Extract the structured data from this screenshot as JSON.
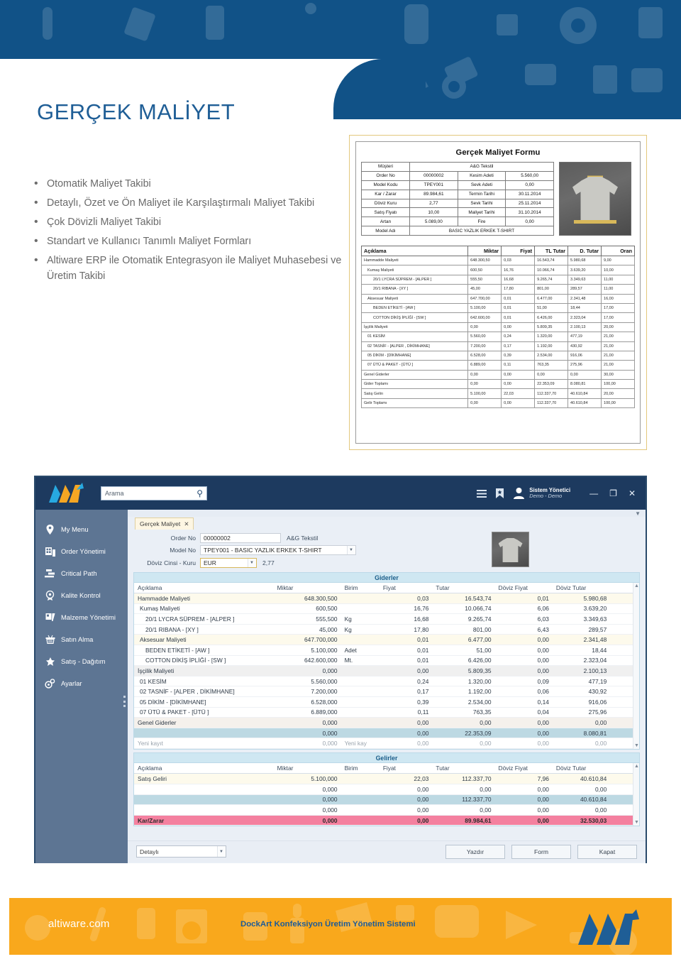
{
  "page": {
    "title": "GERÇEK MALİYET"
  },
  "bullets": [
    "Otomatik Maliyet Takibi",
    "Detaylı, Özet ve Ön Maliyet ile Karşılaştırmalı Maliyet Takibi",
    "Çok Dövizli Maliyet Takibi",
    "Standart ve Kullanıcı Tanımlı Maliyet Formları",
    "Altiware ERP ile Otomatik Entegrasyon ile Maliyet Muhasebesi ve Üretim Takibi"
  ],
  "report": {
    "title": "Gerçek Maliyet Formu",
    "header_rows": [
      {
        "label": "Müşteri",
        "value": "A&G Tekstil",
        "span": true
      },
      {
        "label": "Order No",
        "value": "00000002",
        "label2": "Kesim Adeti",
        "value2": "5.560,00"
      },
      {
        "label": "Model Kodu",
        "value": "TPEY001",
        "label2": "Sevk Adeti",
        "value2": "0,00"
      },
      {
        "label": "Kar / Zarar",
        "value": "89.984,61",
        "label2": "Termin Tarihi",
        "value2": "30.11.2014"
      },
      {
        "label": "Döviz Kuru",
        "value": "2,77",
        "label2": "Sevk Tarihi",
        "value2": "25.11.2014"
      },
      {
        "label": "Satış Fiyatı",
        "value": "10,00",
        "label2": "Maliyet Tarihi",
        "value2": "31.10.2014"
      },
      {
        "label": "Artan",
        "value": "5.089,00",
        "label2": "Fire",
        "value2": "0,00"
      },
      {
        "label": "Model Adı",
        "value": "BASIC YAZLIK ERKEK T-SHIRT",
        "span": true
      }
    ],
    "columns": [
      "Açıklama",
      "Miktar",
      "Fiyat",
      "TL Tutar",
      "D. Tutar",
      "Oran"
    ],
    "rows": [
      {
        "indent": 0,
        "thick": true,
        "cells": [
          "Hammadde Maliyeti",
          "648.300,50",
          "0,03",
          "16.543,74",
          "5.980,68",
          "9,00"
        ]
      },
      {
        "indent": 1,
        "thick": false,
        "cells": [
          "Kumaş Maliyeti",
          "600,50",
          "16,76",
          "10.066,74",
          "3.639,20",
          "10,00"
        ]
      },
      {
        "indent": 2,
        "thick": false,
        "cells": [
          "20/1 LYCRA SÜPREM - [ALPER ]",
          "555,50",
          "16,68",
          "9.265,74",
          "3.349,63",
          "11,00"
        ]
      },
      {
        "indent": 2,
        "thick": false,
        "cells": [
          "20/1 RIBANA - [XY ]",
          "45,00",
          "17,80",
          "801,00",
          "289,57",
          "11,00"
        ]
      },
      {
        "indent": 1,
        "thick": true,
        "cells": [
          "Aksesuar Maliyeti",
          "647.700,00",
          "0,01",
          "6.477,00",
          "2.341,48",
          "16,00"
        ]
      },
      {
        "indent": 2,
        "thick": false,
        "cells": [
          "BEDEN ETİKETİ - [AW ]",
          "5.100,00",
          "0,01",
          "51,00",
          "18,44",
          "17,00"
        ]
      },
      {
        "indent": 2,
        "thick": false,
        "cells": [
          "COTTON DİKİŞ İPLİĞİ - [SW ]",
          "642.600,00",
          "0,01",
          "6.426,00",
          "2.323,04",
          "17,00"
        ]
      },
      {
        "indent": 0,
        "thick": true,
        "cells": [
          "İşçilik Maliyeti",
          "0,00",
          "0,00",
          "5.809,35",
          "2.100,13",
          "20,00"
        ]
      },
      {
        "indent": 1,
        "thick": false,
        "cells": [
          "01  KESİM",
          "5.560,00",
          "0,24",
          "1.320,00",
          "477,19",
          "21,00"
        ]
      },
      {
        "indent": 1,
        "thick": false,
        "cells": [
          "02  TASNİF - [ALPER , DİKİMHANE]",
          "7.200,00",
          "0,17",
          "1.192,00",
          "430,92",
          "21,00"
        ]
      },
      {
        "indent": 1,
        "thick": false,
        "cells": [
          "05  DİKİM - [DİKİMHANE]",
          "6.528,00",
          "0,39",
          "2.534,00",
          "916,06",
          "21,00"
        ]
      },
      {
        "indent": 1,
        "thick": false,
        "cells": [
          "07  ÜTÜ & PAKET - [ÜTÜ ]",
          "6.889,00",
          "0,11",
          "763,35",
          "275,96",
          "21,00"
        ]
      },
      {
        "indent": 0,
        "thick": true,
        "cells": [
          "Genel Giderler",
          "0,00",
          "0,00",
          "0,00",
          "0,00",
          "30,00"
        ]
      },
      {
        "indent": 0,
        "thick": true,
        "cells": [
          "Gider Toplamı",
          "0,00",
          "0,00",
          "22.353,09",
          "8.080,81",
          "100,00"
        ]
      },
      {
        "indent": 0,
        "thick": true,
        "cells": [
          "Satış Gelirı",
          "5.100,00",
          "22,03",
          "112.337,70",
          "40.610,84",
          "20,00"
        ]
      },
      {
        "indent": 0,
        "thick": true,
        "cells": [
          "Gelir Toplamı",
          "0,00",
          "0,00",
          "112.337,70",
          "40.610,84",
          "100,00"
        ]
      }
    ]
  },
  "app": {
    "logo_alt": "AW",
    "search": {
      "placeholder": "Arama"
    },
    "user": {
      "name": "Sistem Yönetici",
      "sub": "Demo - Demo"
    },
    "window_buttons": {
      "minimize": "—",
      "maximize": "❐",
      "close": "✕"
    },
    "sidebar": [
      {
        "label": "My Menu",
        "icon": "pin-icon"
      },
      {
        "label": "Order Yönetimi",
        "icon": "documents-icon"
      },
      {
        "label": "Critical Path",
        "icon": "gantt-icon"
      },
      {
        "label": "Kalite Kontrol",
        "icon": "badge-icon"
      },
      {
        "label": "Malzeme Yönetimi",
        "icon": "cart-icon"
      },
      {
        "label": "Satın Alma",
        "icon": "basket-icon"
      },
      {
        "label": "Satış - Dağıtım",
        "icon": "share-icon"
      },
      {
        "label": "Ayarlar",
        "icon": "gear-icon"
      }
    ],
    "tab": {
      "label": "Gerçek Maliyet",
      "close": "✕"
    },
    "form": {
      "order_no_label": "Order No",
      "order_no_value": "00000002",
      "customer": "A&G Tekstil",
      "model_no_label": "Model No",
      "model_no_value": "TPEY001 - BASIC YAZLIK ERKEK T-SHIRT",
      "currency_label": "Döviz Cinsi - Kuru",
      "currency_value": "EUR",
      "rate_value": "2,77"
    },
    "expenses": {
      "section_title": "Giderler",
      "columns": [
        "Açıklama",
        "Miktar",
        "Birim",
        "Fiyat",
        "Tutar",
        "Döviz Fiyat",
        "Döviz Tutar",
        ""
      ],
      "rows": [
        {
          "style": "r-group",
          "cells": [
            "Hammadde Maliyeti",
            "648.300,500",
            "",
            "0,03",
            "16.543,74",
            "0,01",
            "5.980,68",
            ""
          ],
          "indent": 0
        },
        {
          "style": "",
          "cells": [
            "Kumaş Maliyeti",
            "600,500",
            "",
            "16,76",
            "10.066,74",
            "6,06",
            "3.639,20",
            ""
          ],
          "indent": 1
        },
        {
          "style": "",
          "cells": [
            "20/1 LYCRA SÜPREM - [ALPER ]",
            "555,500",
            "Kg",
            "16,68",
            "9.265,74",
            "6,03",
            "3.349,63",
            ""
          ],
          "indent": 2
        },
        {
          "style": "",
          "cells": [
            "20/1 RIBANA - [XY ]",
            "45,000",
            "Kg",
            "17,80",
            "801,00",
            "6,43",
            "289,57",
            ""
          ],
          "indent": 2
        },
        {
          "style": "r-group",
          "cells": [
            "Aksesuar Maliyeti",
            "647.700,000",
            "",
            "0,01",
            "6.477,00",
            "0,00",
            "2.341,48",
            ""
          ],
          "indent": 1
        },
        {
          "style": "",
          "cells": [
            "BEDEN ETİKETİ - [AW ]",
            "5.100,000",
            "Adet",
            "0,01",
            "51,00",
            "0,00",
            "18,44",
            ""
          ],
          "indent": 2
        },
        {
          "style": "",
          "cells": [
            "COTTON DİKİŞ İPLİĞİ - [SW ]",
            "642.600,000",
            "Mt.",
            "0,01",
            "6.426,00",
            "0,00",
            "2.323,04",
            ""
          ],
          "indent": 2
        },
        {
          "style": "r-alt",
          "cells": [
            "İşçilik Maliyeti",
            "0,000",
            "",
            "0,00",
            "5.809,35",
            "0,00",
            "2.100,13",
            ""
          ],
          "indent": 0
        },
        {
          "style": "",
          "cells": [
            "01  KESİM",
            "5.560,000",
            "",
            "0,24",
            "1.320,00",
            "0,09",
            "477,19",
            ""
          ],
          "indent": 1
        },
        {
          "style": "",
          "cells": [
            "02  TASNİF - [ALPER , DİKİMHANE]",
            "7.200,000",
            "",
            "0,17",
            "1.192,00",
            "0,06",
            "430,92",
            ""
          ],
          "indent": 1
        },
        {
          "style": "",
          "cells": [
            "05  DİKİM - [DİKİMHANE]",
            "6.528,000",
            "",
            "0,39",
            "2.534,00",
            "0,14",
            "916,06",
            ""
          ],
          "indent": 1
        },
        {
          "style": "",
          "cells": [
            "07  ÜTÜ & PAKET - [ÜTÜ ]",
            "6.889,000",
            "",
            "0,11",
            "763,35",
            "0,04",
            "275,96",
            ""
          ],
          "indent": 1
        },
        {
          "style": "r-group2",
          "cells": [
            "Genel Giderler",
            "0,000",
            "",
            "0,00",
            "0,00",
            "0,00",
            "0,00",
            ""
          ],
          "indent": 0
        },
        {
          "style": "r-sum",
          "cells": [
            "",
            "0,000",
            "",
            "0,00",
            "22.353,09",
            "0,00",
            "8.080,81",
            ""
          ],
          "indent": 0
        },
        {
          "style": "r-new",
          "cells": [
            "Yeni kayıt",
            "0,000",
            "Yeni kay",
            "0,00",
            "0,00",
            "0,00",
            "0,00",
            ""
          ],
          "indent": 0
        }
      ]
    },
    "income": {
      "section_title": "Gelirler",
      "columns": [
        "Açıklama",
        "Miktar",
        "Birim",
        "Fiyat",
        "Tutar",
        "Döviz Fiyat",
        "Döviz Tutar",
        ""
      ],
      "rows": [
        {
          "style": "r-inc1",
          "cells": [
            "Satış Geliri",
            "5.100,000",
            "",
            "22,03",
            "112.337,70",
            "7,96",
            "40.610,84",
            ""
          ],
          "indent": 0
        },
        {
          "style": "",
          "cells": [
            "",
            "0,000",
            "",
            "0,00",
            "0,00",
            "0,00",
            "0,00",
            ""
          ],
          "indent": 0
        },
        {
          "style": "r-inc3",
          "cells": [
            "",
            "0,000",
            "",
            "0,00",
            "112.337,70",
            "0,00",
            "40.610,84",
            ""
          ],
          "indent": 0
        },
        {
          "style": "",
          "cells": [
            "",
            "0,000",
            "",
            "0,00",
            "0,00",
            "0,00",
            "0,00",
            ""
          ],
          "indent": 0
        },
        {
          "style": "r-profit",
          "cells": [
            "Kar/Zarar",
            "0,000",
            "",
            "0,00",
            "89.984,61",
            "0,00",
            "32.530,03",
            ""
          ],
          "indent": 0
        }
      ]
    },
    "footer": {
      "mode_value": "Detaylı",
      "buttons": [
        "Yazdır",
        "Form",
        "Kapat"
      ]
    }
  },
  "footer": {
    "site": "altiware.com",
    "center": "DockArt Konfeksiyon Üretim Yönetim Sistemi"
  },
  "colors": {
    "banner_blue": "#115287",
    "title_blue": "#1f5e96",
    "sidebar": "#5d7593",
    "titlebar": "#1d3a5f",
    "accent_orange": "#f9a81c",
    "profit_pink": "#f4809f",
    "section_blue": "#cfe7f2",
    "card_border": "#e3c87d"
  }
}
